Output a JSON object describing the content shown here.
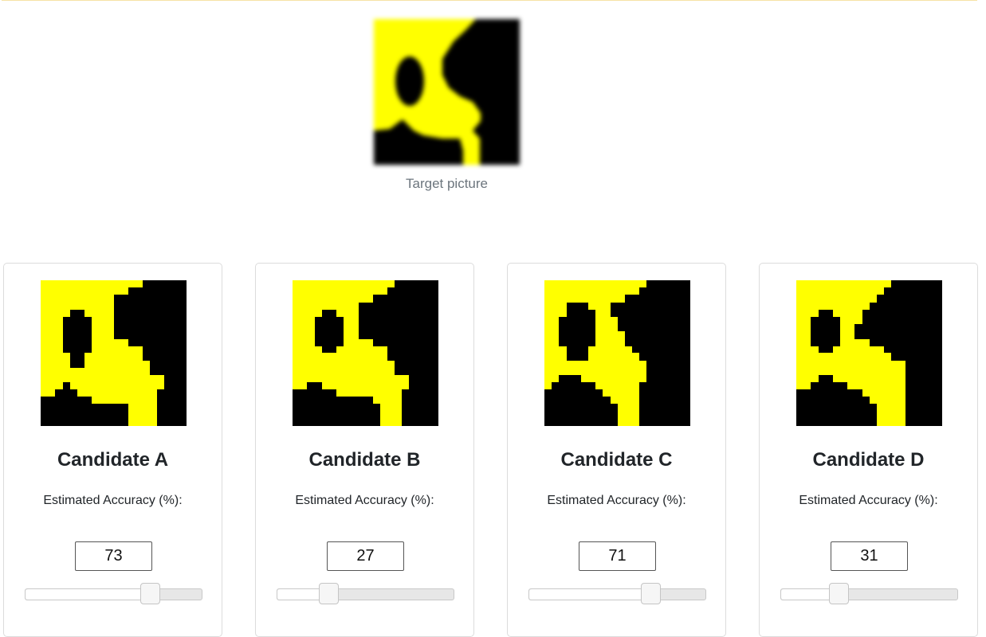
{
  "target": {
    "caption": "Target picture"
  },
  "colors": {
    "yellow": "#ffff00",
    "black": "#000000"
  },
  "candidates": [
    {
      "title": "Candidate A",
      "label": "Estimated Accuracy (%):",
      "value": "73",
      "slider_percent": 73
    },
    {
      "title": "Candidate B",
      "label": "Estimated Accuracy (%):",
      "value": "27",
      "slider_percent": 27
    },
    {
      "title": "Candidate C",
      "label": "Estimated Accuracy (%):",
      "value": "71",
      "slider_percent": 71
    },
    {
      "title": "Candidate D",
      "label": "Estimated Accuracy (%):",
      "value": "31",
      "slider_percent": 31
    }
  ]
}
